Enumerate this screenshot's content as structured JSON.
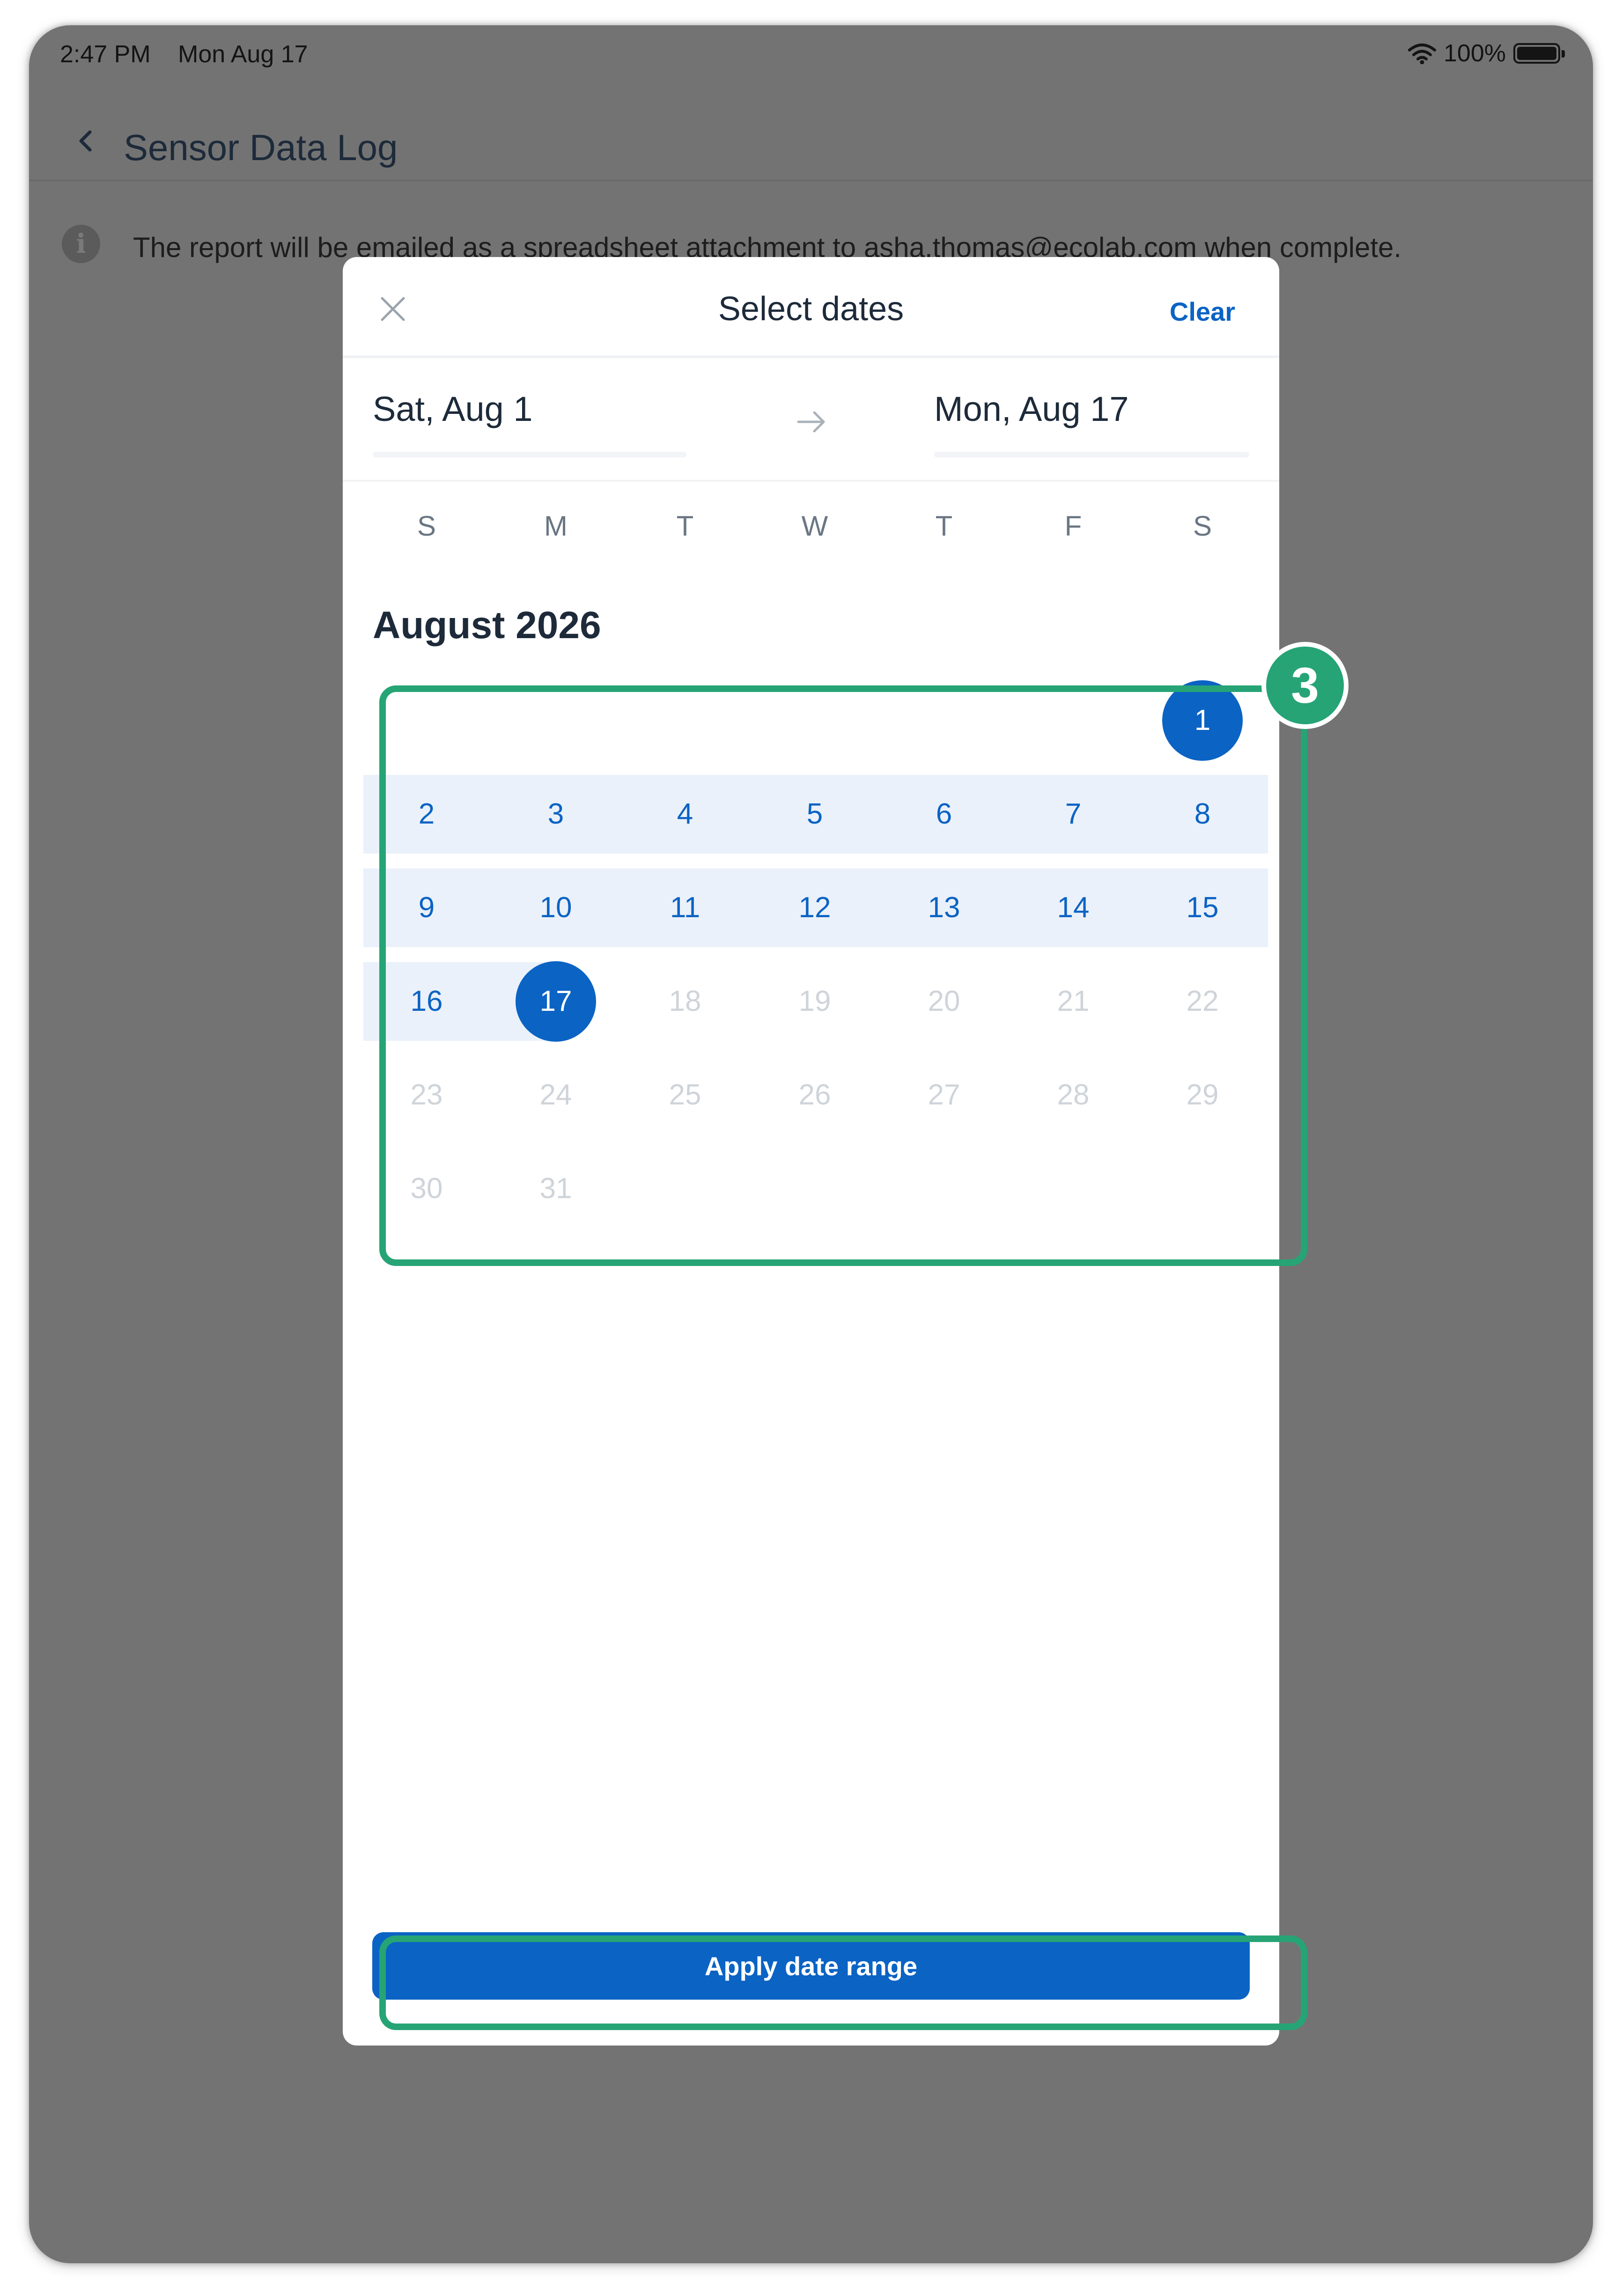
{
  "status_bar": {
    "time": "2:47 PM",
    "date": "Mon Aug 17",
    "battery": "100%"
  },
  "nav": {
    "title": "Sensor Data Log"
  },
  "info": {
    "message": "The report will be emailed as a spreadsheet attachment to asha.thomas@ecolab.com when complete."
  },
  "modal": {
    "title": "Select dates",
    "clear_label": "Clear",
    "start_date": "Sat, Aug 1",
    "end_date": "Mon, Aug 17",
    "apply_label": "Apply date range"
  },
  "calendar": {
    "month_label": "August 2026",
    "weekdays": [
      "S",
      "M",
      "T",
      "W",
      "T",
      "F",
      "S"
    ],
    "first_weekday_index": 6,
    "days_in_month": 31,
    "range_start": 1,
    "range_end": 17,
    "last_selectable_day": 17
  },
  "annotation": {
    "step_number": "3"
  },
  "colors": {
    "accent": "#0b63c4",
    "range_band": "#eaf1fa",
    "disabled_day": "#cfd4da",
    "callout": "#26a476",
    "overlay": "#737373"
  }
}
